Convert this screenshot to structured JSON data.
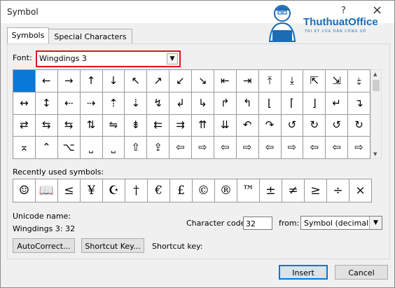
{
  "window": {
    "title": "Symbol",
    "help": "?",
    "close": "×"
  },
  "logo": {
    "name": "ThuthuatOffice",
    "tagline": "TRI KỶ CỦA DÂN CÔNG SỞ"
  },
  "tabs": [
    {
      "label": "Symbols",
      "mnemonic": "S"
    },
    {
      "label": "Special Characters",
      "mnemonic": "P"
    }
  ],
  "font": {
    "label": "Font:",
    "value": "Wingdings 3",
    "highlight": "#e1141c"
  },
  "symbols": [
    "",
    "←",
    "→",
    "↑",
    "↓",
    "↖",
    "↗",
    "↙",
    "↘",
    "⇤",
    "⇥",
    "⤒",
    "⤓",
    "⇱",
    "⇲",
    "⤈",
    "↔",
    "↕",
    "⇠",
    "⇢",
    "⇡",
    "⇣",
    "↯",
    "↲",
    "↳",
    "↱",
    "↰",
    "⌊",
    "⌈",
    "⌋",
    "↵",
    "↴",
    "⇄",
    "⇆",
    "⇆",
    "⇅",
    "⇋",
    "⇟",
    "⇇",
    "⇉",
    "⇈",
    "⇊",
    "↶",
    "↷",
    "↺",
    "↻",
    "↺",
    "↻",
    "⌅",
    "⌃",
    "⌥",
    "⎵",
    "⎵",
    "⇧",
    "⇪",
    "⇦",
    "⇨",
    "⇦",
    "⇨",
    "⇦",
    "⇨",
    "⇦",
    "⇦",
    "⇨"
  ],
  "recent": {
    "label": "Recently used symbols:",
    "items": [
      "☺",
      "📖",
      "≤",
      "¥",
      "☪",
      "†",
      "€",
      "£",
      "©",
      "®",
      "™",
      "±",
      "≠",
      "≥",
      "÷",
      "×",
      "∞"
    ]
  },
  "unicode": {
    "label": "Unicode name:",
    "value": "Wingdings 3: 32"
  },
  "char_code": {
    "label": "Character code:",
    "value": "32"
  },
  "from": {
    "label": "from:",
    "value": "Symbol (decimal)"
  },
  "buttons": {
    "autocorrect": "AutoCorrect...",
    "shortcut_key": "Shortcut Key...",
    "insert": "Insert",
    "cancel": "Cancel"
  },
  "shortcut": {
    "label": "Shortcut key:"
  },
  "colors": {
    "selected": "#0a78d7",
    "primary_border": "#0078d7"
  }
}
